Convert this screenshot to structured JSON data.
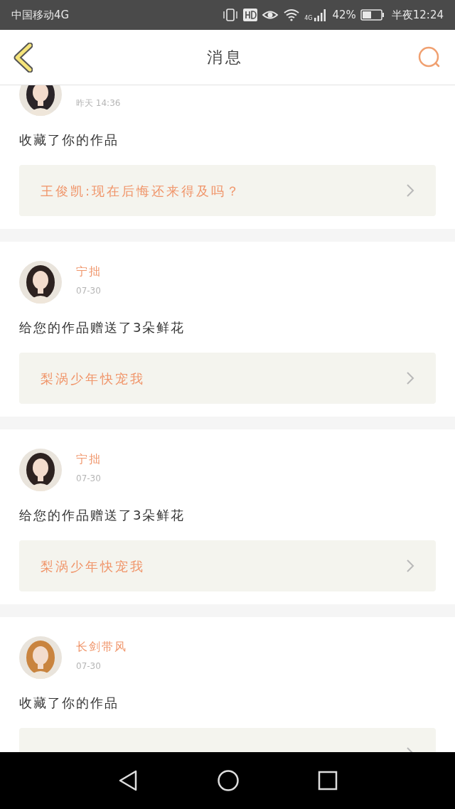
{
  "status_bar": {
    "carrier": "中国移动4G",
    "network": "4G",
    "battery": "42%",
    "time": "半夜12:24"
  },
  "header": {
    "title": "消息"
  },
  "messages": [
    {
      "time": "昨天 14:36",
      "action": "收藏了你的作品",
      "work": "王俊凯:现在后悔还来得及吗？"
    },
    {
      "name": "宁拙",
      "time": "07-30",
      "action": "给您的作品赠送了3朵鲜花",
      "work": "梨涡少年快宠我"
    },
    {
      "name": "宁拙",
      "time": "07-30",
      "action": "给您的作品赠送了3朵鲜花",
      "work": "梨涡少年快宠我"
    },
    {
      "name": "长剑带风",
      "time": "07-30",
      "action": "收藏了你的作品"
    }
  ]
}
